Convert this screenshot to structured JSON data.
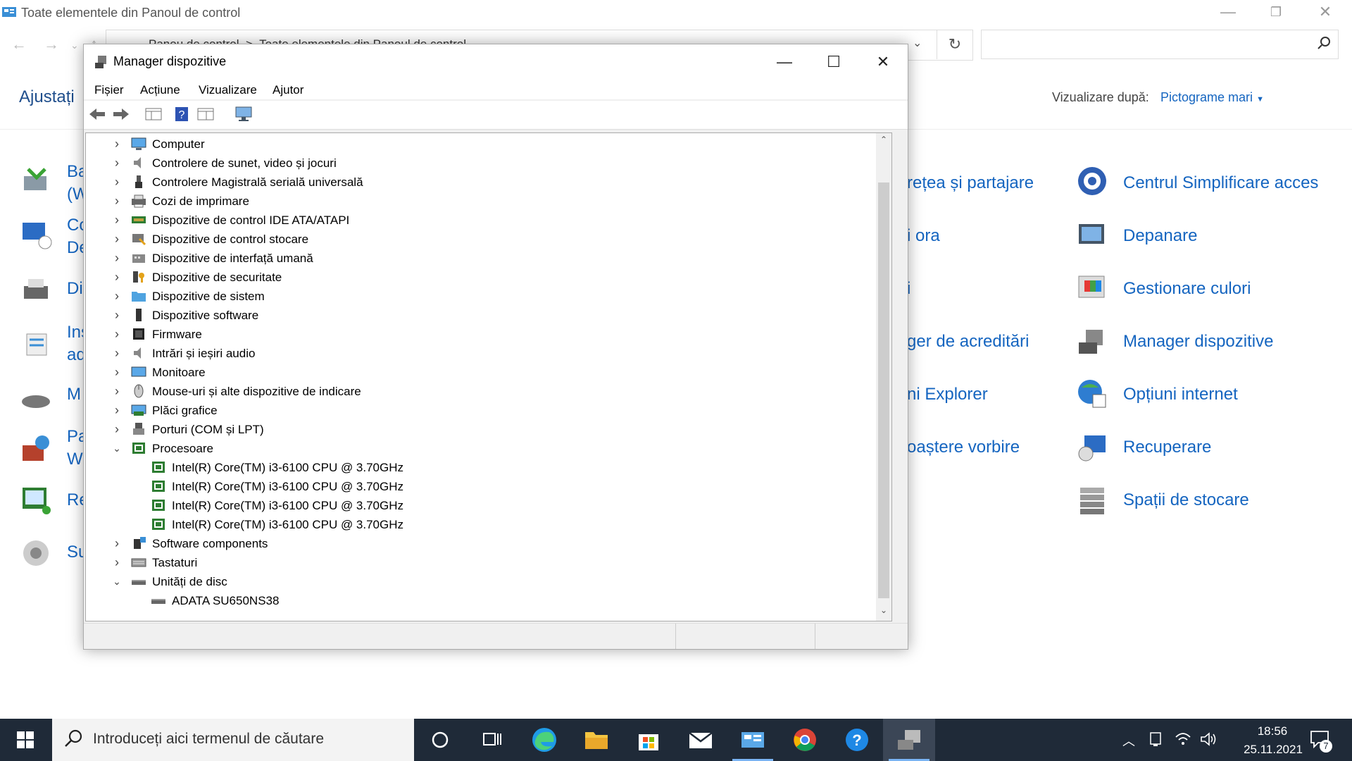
{
  "control_panel": {
    "window_title": "Toate elementele din Panoul de control",
    "breadcrumb": [
      "Panou de control",
      "Toate elementele din Panoul de control"
    ],
    "heading": "Ajustați",
    "view_by_label": "Vizualizare după:",
    "view_by_value": "Pictograme mari",
    "right_column": [
      "Centrul Simplificare acces",
      "Depanare",
      "Gestionare culori",
      "Manager dispozitive",
      "Opțiuni internet",
      "Recuperare",
      "Spații de stocare"
    ],
    "middle_column": [
      "rețea și partajare",
      "i ora",
      "i",
      "ger de acreditări",
      "ni Explorer",
      "oaștere vorbire",
      ""
    ],
    "left_fragments": [
      {
        "l1": "Ba",
        "l2": "(W"
      },
      {
        "l1": "Co",
        "l2": "De"
      },
      {
        "l1": "Di",
        "l2": ""
      },
      {
        "l1": "Ins",
        "l2": "ad"
      },
      {
        "l1": "M",
        "l2": ""
      },
      {
        "l1": "Pa",
        "l2": "W"
      },
      {
        "l1": "Re",
        "l2": ""
      },
      {
        "l1": "Su",
        "l2": ""
      }
    ]
  },
  "device_manager": {
    "title": "Manager dispozitive",
    "menu": [
      "Fișier",
      "Acțiune",
      "Vizualizare",
      "Ajutor"
    ],
    "tree": [
      {
        "label": "Computer",
        "state": "collapsed",
        "icon": "computer-icon"
      },
      {
        "label": "Controlere de sunet, video și jocuri",
        "state": "collapsed",
        "icon": "speaker-icon"
      },
      {
        "label": "Controlere Magistrală serială universală",
        "state": "collapsed",
        "icon": "usb-icon"
      },
      {
        "label": "Cozi de imprimare",
        "state": "collapsed",
        "icon": "printer-icon"
      },
      {
        "label": "Dispozitive de control IDE ATA/ATAPI",
        "state": "collapsed",
        "icon": "ide-icon"
      },
      {
        "label": "Dispozitive de control stocare",
        "state": "collapsed",
        "icon": "storage-controller-icon"
      },
      {
        "label": "Dispozitive de interfață umană",
        "state": "collapsed",
        "icon": "hid-icon"
      },
      {
        "label": "Dispozitive de securitate",
        "state": "collapsed",
        "icon": "security-icon"
      },
      {
        "label": "Dispozitive de sistem",
        "state": "collapsed",
        "icon": "system-folder-icon"
      },
      {
        "label": "Dispozitive software",
        "state": "collapsed",
        "icon": "software-device-icon"
      },
      {
        "label": "Firmware",
        "state": "collapsed",
        "icon": "firmware-icon"
      },
      {
        "label": "Intrări și ieșiri audio",
        "state": "collapsed",
        "icon": "speaker-icon"
      },
      {
        "label": "Monitoare",
        "state": "collapsed",
        "icon": "monitor-icon"
      },
      {
        "label": "Mouse-uri și alte dispozitive de indicare",
        "state": "collapsed",
        "icon": "mouse-icon"
      },
      {
        "label": "Plăci grafice",
        "state": "collapsed",
        "icon": "display-adapter-icon"
      },
      {
        "label": "Porturi (COM și LPT)",
        "state": "collapsed",
        "icon": "port-icon"
      },
      {
        "label": "Procesoare",
        "state": "expanded",
        "icon": "processor-icon"
      },
      {
        "label": "Intel(R) Core(TM) i3-6100 CPU @ 3.70GHz",
        "state": "child",
        "icon": "processor-icon"
      },
      {
        "label": "Intel(R) Core(TM) i3-6100 CPU @ 3.70GHz",
        "state": "child",
        "icon": "processor-icon"
      },
      {
        "label": "Intel(R) Core(TM) i3-6100 CPU @ 3.70GHz",
        "state": "child",
        "icon": "processor-icon"
      },
      {
        "label": "Intel(R) Core(TM) i3-6100 CPU @ 3.70GHz",
        "state": "child",
        "icon": "processor-icon"
      },
      {
        "label": "Software components",
        "state": "collapsed",
        "icon": "software-components-icon"
      },
      {
        "label": "Tastaturi",
        "state": "collapsed",
        "icon": "keyboard-icon"
      },
      {
        "label": "Unități de disc",
        "state": "expanded",
        "icon": "disk-icon"
      },
      {
        "label": "ADATA SU650NS38",
        "state": "child",
        "icon": "disk-icon"
      }
    ]
  },
  "taskbar": {
    "search_placeholder": "Introduceți aici termenul de căutare",
    "time": "18:56",
    "date": "25.11.2021",
    "notification_count": "7",
    "apps": [
      "cortana",
      "task-view",
      "edge",
      "file-explorer",
      "store",
      "mail",
      "control-panel",
      "chrome",
      "help",
      "device-manager"
    ]
  }
}
